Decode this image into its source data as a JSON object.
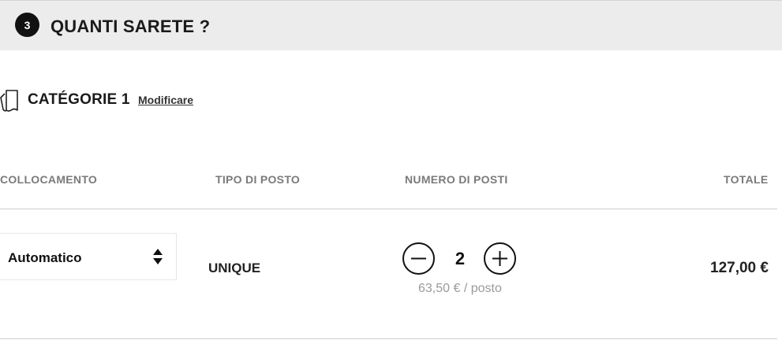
{
  "step": {
    "number": "3",
    "title": "QUANTI SARETE ?"
  },
  "category": {
    "icon": "ticket-icon",
    "name": "CATÉGORIE 1",
    "edit_label": "Modificare"
  },
  "table": {
    "headers": {
      "placement": "COLLOCAMENTO",
      "seat_type": "TIPO DI POSTO",
      "quantity": "NUMERO DI POSTI",
      "total": "TOTALE"
    },
    "row": {
      "placement_selected": "Automatico",
      "seat_type": "UNIQUE",
      "quantity": "2",
      "unit_price": "63,50 € / posto",
      "total": "127,00 €"
    }
  },
  "colors": {
    "header_bg": "#ececec",
    "badge_bg": "#111111",
    "muted_text": "#7a7a7a"
  },
  "icons": {
    "select": "sort-arrows-icon",
    "decrement": "minus-circle-icon",
    "increment": "plus-circle-icon"
  }
}
